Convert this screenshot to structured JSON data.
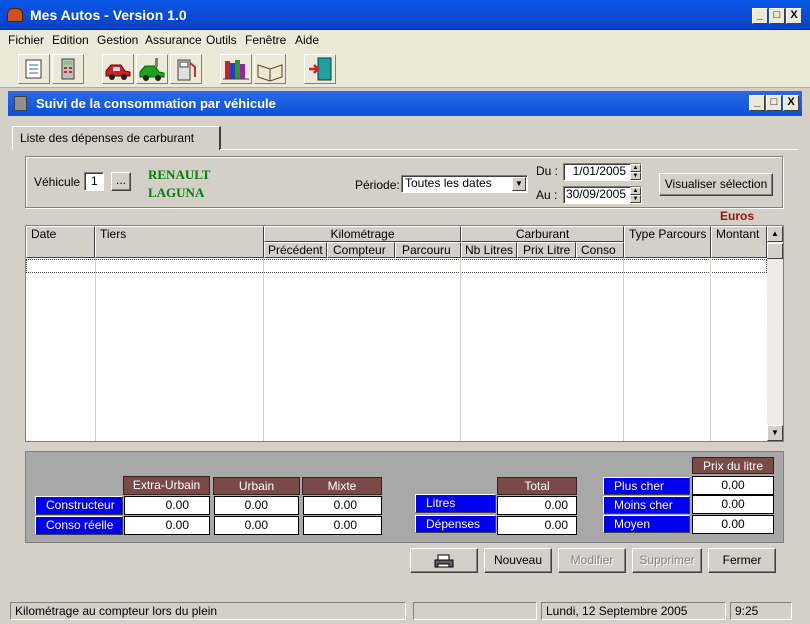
{
  "app": {
    "title": "Mes Autos - Version 1.0",
    "window_buttons": [
      "_",
      "□",
      "X"
    ]
  },
  "menu": [
    "Fichier",
    "Edition",
    "Gestion",
    "Assurance",
    "Outils",
    "Fenêtre",
    "Aide"
  ],
  "toolbar_icons": [
    "document-icon",
    "calculator-icon",
    "cars-icon",
    "car-service-icon",
    "fuel-pump-icon",
    "books-icon",
    "open-book-icon",
    "exit-door-icon"
  ],
  "child": {
    "title": "Suivi de la consommation par véhicule",
    "window_buttons": [
      "_",
      "□",
      "X"
    ]
  },
  "tab": {
    "label": "Liste des dépenses de carburant"
  },
  "vehicle": {
    "label": "Véhicule :",
    "value": "1",
    "browse_label": "...",
    "make": "RENAULT",
    "model": "LAGUNA"
  },
  "period": {
    "label": "Période:",
    "selected": "Toutes les dates",
    "from_label": "Du :",
    "from_value": "1/01/2005",
    "to_label": "Au :",
    "to_value": "30/09/2005",
    "visualize_label": "Visualiser sélection"
  },
  "currency_label": "Euros",
  "table": {
    "columns": {
      "date": "Date",
      "tiers": "Tiers",
      "kilometrage": "Kilométrage",
      "precedent": "Précédent",
      "compteur": "Compteur",
      "parcouru": "Parcouru",
      "carburant": "Carburant",
      "nb_litres": "Nb Litres",
      "prix_litre": "Prix Litre",
      "conso": "Conso",
      "type_parcours": "Type Parcours",
      "montant": "Montant"
    },
    "scroll_up": "▲",
    "scroll_down": "▼"
  },
  "summary": {
    "headers": {
      "extra_urbain": "Extra-Urbain",
      "urbain": "Urbain",
      "mixte": "Mixte",
      "total": "Total",
      "prix_du_litre": "Prix du litre"
    },
    "rows": {
      "constructeur": {
        "label": "Constructeur",
        "extra_urbain": "0.00",
        "urbain": "0.00",
        "mixte": "0.00"
      },
      "conso_reelle": {
        "label": "Conso réelle",
        "extra_urbain": "0.00",
        "urbain": "0.00",
        "mixte": "0.00"
      }
    },
    "totals": {
      "litres": {
        "label": "Litres",
        "value": "0.00"
      },
      "depenses": {
        "label": "Dépenses",
        "value": "0.00"
      }
    },
    "prices": {
      "plus_cher": {
        "label": "Plus cher",
        "value": "0.00"
      },
      "moins_cher": {
        "label": "Moins cher",
        "value": "0.00"
      },
      "moyen": {
        "label": "Moyen",
        "value": "0.00"
      }
    }
  },
  "actions": {
    "nouveau": "Nouveau",
    "modifier": "Modifier",
    "supprimer": "Supprimer",
    "fermer": "Fermer"
  },
  "status": {
    "hint": "Kilométrage au compteur lors du plein",
    "date": "Lundi, 12 Septembre 2005",
    "time": "9:25"
  }
}
